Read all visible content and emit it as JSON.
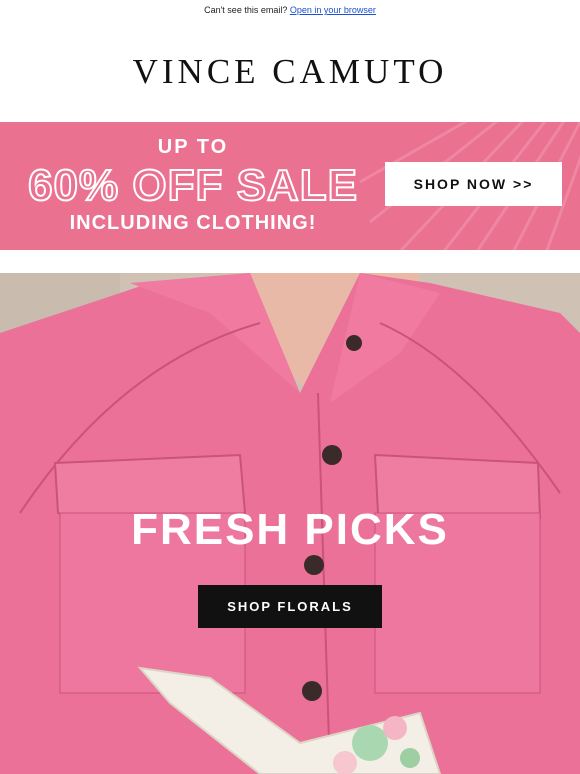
{
  "preheader": {
    "text": "Can't see this email?",
    "link_label": "Open in your browser"
  },
  "brand": {
    "logo_text": "VINCE CAMUTO"
  },
  "sale_banner": {
    "line1": "UP TO",
    "line2": "60% OFF SALE",
    "line3": "INCLUDING CLOTHING!",
    "cta_label": "SHOP NOW >>",
    "background_color": "#ea7190"
  },
  "hero": {
    "headline": "FRESH PICKS",
    "cta_label": "SHOP FLORALS",
    "shirt_color": "#ec7199"
  }
}
